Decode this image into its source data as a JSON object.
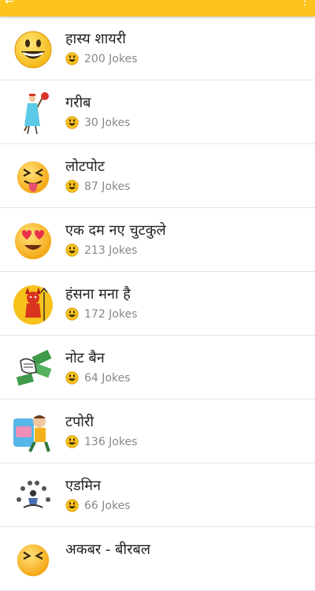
{
  "colors": {
    "accent": "#FDC41E",
    "divider": "#e4e4e4",
    "meta_text": "#888888"
  },
  "categories": [
    {
      "title": "हास्य शायरी",
      "count": "200 Jokes",
      "icon": "grinning-face-icon"
    },
    {
      "title": "गरीब",
      "count": "30 Jokes",
      "icon": "poor-man-icon"
    },
    {
      "title": "लोटपोट",
      "count": "87 Jokes",
      "icon": "tongue-face-icon"
    },
    {
      "title": "एक दम नए चुटकुले",
      "count": "213 Jokes",
      "icon": "heart-eyes-face-icon"
    },
    {
      "title": "हंसना मना है",
      "count": "172 Jokes",
      "icon": "devil-icon"
    },
    {
      "title": "नोट बैन",
      "count": "64 Jokes",
      "icon": "money-fist-icon"
    },
    {
      "title": "टपोरी",
      "count": "136 Jokes",
      "icon": "tapori-cartoon-icon"
    },
    {
      "title": "एडमिन",
      "count": "66 Jokes",
      "icon": "admin-juggler-icon"
    },
    {
      "title": "अकबर - बीरबल",
      "count": "",
      "icon": "tongue-face-icon"
    }
  ]
}
